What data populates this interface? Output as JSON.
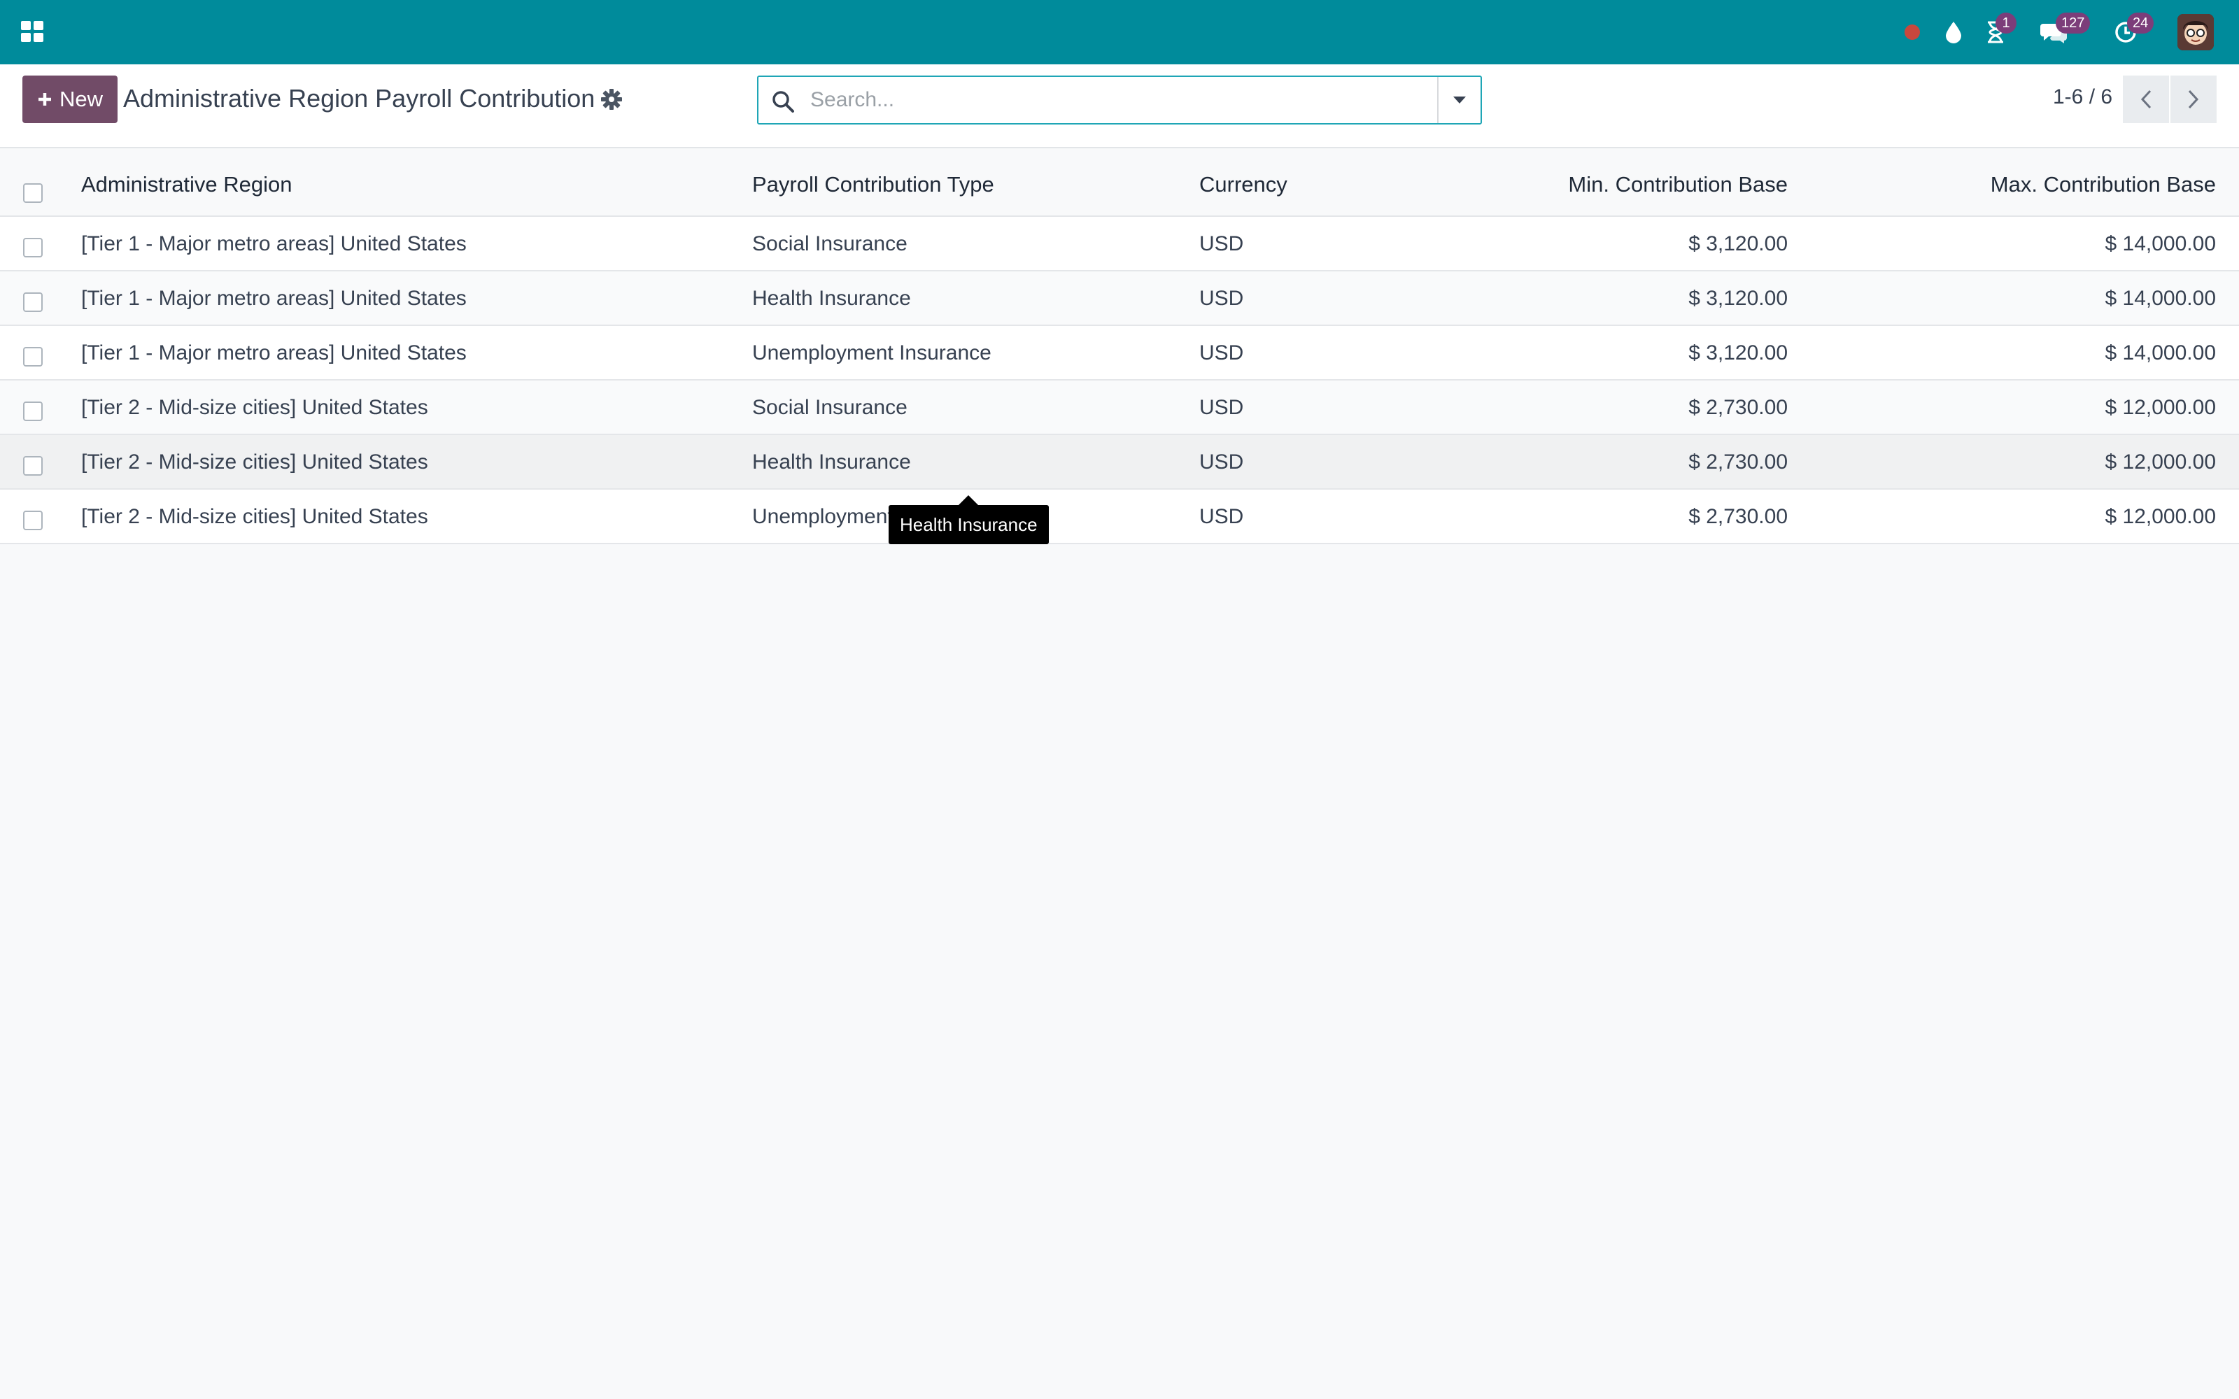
{
  "navbar": {
    "color": "#008b9b",
    "icons": [
      "apps-icon",
      "record-dot-icon",
      "drop-icon",
      "hourglass-icon",
      "chat-icon",
      "clock-icon"
    ],
    "hourglass_badge": "1",
    "messages_badge": "127",
    "activities_badge": "24"
  },
  "control_panel": {
    "new_button_label": "New",
    "title": "Administrative Region Payroll Contribution",
    "search_placeholder": "Search...",
    "pager": "1-6 / 6"
  },
  "table": {
    "headers": {
      "region": "Administrative Region",
      "type": "Payroll Contribution Type",
      "currency": "Currency",
      "min": "Min. Contribution Base",
      "max": "Max. Contribution Base"
    },
    "rows": [
      {
        "region": "[Tier 1 - Major metro areas] United States",
        "type": "Social Insurance",
        "currency": "USD",
        "min": "$ 3,120.00",
        "max": "$ 14,000.00"
      },
      {
        "region": "[Tier 1 - Major metro areas] United States",
        "type": "Health Insurance",
        "currency": "USD",
        "min": "$ 3,120.00",
        "max": "$ 14,000.00"
      },
      {
        "region": "[Tier 1 - Major metro areas] United States",
        "type": "Unemployment Insurance",
        "currency": "USD",
        "min": "$ 3,120.00",
        "max": "$ 14,000.00"
      },
      {
        "region": "[Tier 2 - Mid-size cities] United States",
        "type": "Social Insurance",
        "currency": "USD",
        "min": "$ 2,730.00",
        "max": "$ 12,000.00"
      },
      {
        "region": "[Tier 2 - Mid-size cities] United States",
        "type": "Health Insurance",
        "currency": "USD",
        "min": "$ 2,730.00",
        "max": "$ 12,000.00"
      },
      {
        "region": "[Tier 2 - Mid-size cities] United States",
        "type": "Unemployment",
        "currency": "USD",
        "min": "$ 2,730.00",
        "max": "$ 12,000.00"
      }
    ]
  },
  "tooltip": {
    "text": "Health Insurance"
  },
  "colors": {
    "brand": "#714b67",
    "navbar": "#008b9b",
    "badge": "#7c3d7a",
    "search_border": "#1fa6b6"
  }
}
